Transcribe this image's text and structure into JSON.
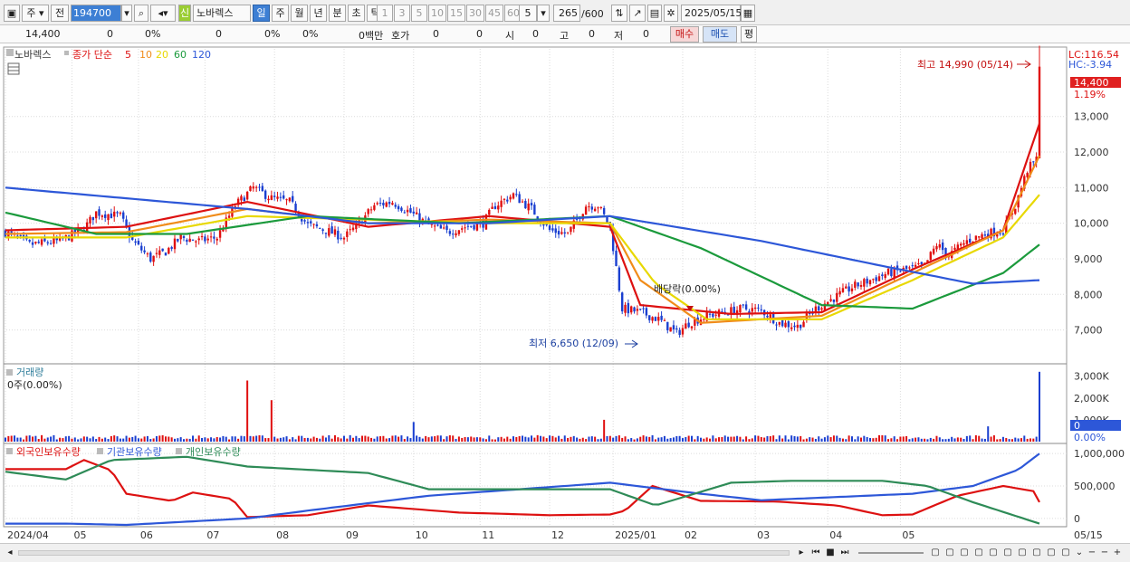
{
  "toolbar": {
    "period_type": "주",
    "prev_label": "전",
    "code": "194700",
    "market_badge": "신",
    "stock_name": "노바렉스",
    "period_buttons": [
      "일",
      "주",
      "월",
      "년",
      "분",
      "초",
      "틱"
    ],
    "selected_period": "일",
    "interval_buttons": [
      "1",
      "3",
      "5",
      "10",
      "15",
      "30",
      "45",
      "60"
    ],
    "interval_value": "5",
    "count_value": "265",
    "count_max": "/600",
    "date": "2025/05/15"
  },
  "quote": {
    "price": "14,400",
    "change": "0",
    "change_pct": "0%",
    "volume": "0",
    "volume_pct": "0%",
    "turnover_pct": "0%",
    "amount": "0백만",
    "hoga_label": "호가",
    "hoga_v1": "0",
    "hoga_v2": "0",
    "open_label": "시",
    "open_v": "0",
    "high_label": "고",
    "high_v": "0",
    "low_label": "저",
    "low_v": "0",
    "buy_label": "매수",
    "sell_label": "매도",
    "avg_label": "평"
  },
  "price_panel": {
    "stock_label": "노바렉스",
    "ma_label": "종가 단순",
    "ma_periods": [
      "5",
      "10",
      "20",
      "60",
      "120"
    ],
    "ma_colors": [
      "#dd1111",
      "#f08c1a",
      "#e8d800",
      "#1b9a3c",
      "#2d57d8"
    ],
    "lc_text": "LC:116.54",
    "hc_text": "HC:-3.94",
    "current_price_tag": "14,400",
    "current_pct_tag": "1.19%",
    "max_annotation": "최고 14,990 (05/14)",
    "min_annotation": "최저 6,650 (12/09)",
    "dividend_annotation": "배당락(0.00%)"
  },
  "volume_panel": {
    "title": "거래량",
    "info": "0주(0.00%)",
    "current_tag": "0",
    "current_pct_tag": "0.00%"
  },
  "holdings_panel": {
    "series_labels": [
      "외국인보유수량",
      "기관보유수량",
      "개인보유수량"
    ],
    "series_colors": [
      "#dd1111",
      "#2d57d8",
      "#2e8b57"
    ]
  },
  "chart_data": [
    {
      "type": "candlestick",
      "title": "노바렉스",
      "x": [
        "2024/04",
        "05",
        "06",
        "07",
        "08",
        "09",
        "10",
        "11",
        "12",
        "2025/01",
        "02",
        "03",
        "04",
        "05"
      ],
      "y_ticks": [
        7000,
        8000,
        9000,
        10000,
        11000,
        12000,
        13000
      ],
      "y_tick_labels": [
        "7,000",
        "8,000",
        "9,000",
        "10,000",
        "11,000",
        "12,000",
        "13,000"
      ],
      "ylim": [
        6100,
        14900
      ],
      "close_path": [
        [
          0,
          9750
        ],
        [
          8,
          9400
        ],
        [
          18,
          9500
        ],
        [
          26,
          9850
        ],
        [
          30,
          10300
        ],
        [
          38,
          10200
        ],
        [
          42,
          9500
        ],
        [
          48,
          9000
        ],
        [
          53,
          9200
        ],
        [
          58,
          9600
        ],
        [
          64,
          9500
        ],
        [
          70,
          9600
        ],
        [
          76,
          10500
        ],
        [
          82,
          11000
        ],
        [
          88,
          10700
        ],
        [
          94,
          10600
        ],
        [
          100,
          9950
        ],
        [
          106,
          9800
        ],
        [
          112,
          9600
        ],
        [
          116,
          9900
        ],
        [
          122,
          10500
        ],
        [
          128,
          10600
        ],
        [
          134,
          10300
        ],
        [
          140,
          9950
        ],
        [
          146,
          9750
        ],
        [
          152,
          9900
        ],
        [
          158,
          10000
        ],
        [
          162,
          10500
        ],
        [
          168,
          10800
        ],
        [
          174,
          10400
        ],
        [
          180,
          9800
        ],
        [
          186,
          9700
        ],
        [
          192,
          10500
        ],
        [
          196,
          10500
        ],
        [
          200,
          9900
        ],
        [
          204,
          7600
        ],
        [
          210,
          7500
        ],
        [
          216,
          7300
        ],
        [
          222,
          6900
        ],
        [
          226,
          7200
        ],
        [
          232,
          7400
        ],
        [
          238,
          7500
        ],
        [
          244,
          7600
        ],
        [
          250,
          7550
        ],
        [
          256,
          7200
        ],
        [
          262,
          7100
        ],
        [
          268,
          7600
        ],
        [
          274,
          7900
        ],
        [
          280,
          8200
        ],
        [
          286,
          8400
        ],
        [
          292,
          8600
        ],
        [
          298,
          8700
        ],
        [
          304,
          8800
        ],
        [
          308,
          9400
        ],
        [
          312,
          9100
        ],
        [
          318,
          9500
        ],
        [
          324,
          9700
        ],
        [
          330,
          9800
        ],
        [
          334,
          10500
        ],
        [
          338,
          11500
        ],
        [
          341,
          11800
        ],
        [
          342,
          14400
        ]
      ],
      "ma_paths": [
        {
          "name": "5",
          "points": [
            [
              0,
              9800
            ],
            [
              40,
              9900
            ],
            [
              80,
              10600
            ],
            [
              120,
              9900
            ],
            [
              160,
              10200
            ],
            [
              200,
              9900
            ],
            [
              210,
              7700
            ],
            [
              240,
              7450
            ],
            [
              270,
              7500
            ],
            [
              300,
              8700
            ],
            [
              330,
              9800
            ],
            [
              342,
              12800
            ]
          ]
        },
        {
          "name": "10",
          "points": [
            [
              0,
              9700
            ],
            [
              40,
              9750
            ],
            [
              80,
              10400
            ],
            [
              120,
              10000
            ],
            [
              160,
              10100
            ],
            [
              200,
              10000
            ],
            [
              210,
              8400
            ],
            [
              230,
              7200
            ],
            [
              270,
              7400
            ],
            [
              300,
              8600
            ],
            [
              330,
              9800
            ],
            [
              342,
              11900
            ]
          ]
        },
        {
          "name": "20",
          "points": [
            [
              0,
              9600
            ],
            [
              40,
              9600
            ],
            [
              80,
              10200
            ],
            [
              120,
              10100
            ],
            [
              160,
              10000
            ],
            [
              200,
              10000
            ],
            [
              215,
              8300
            ],
            [
              232,
              7300
            ],
            [
              270,
              7300
            ],
            [
              300,
              8400
            ],
            [
              330,
              9600
            ],
            [
              342,
              10800
            ]
          ]
        },
        {
          "name": "60",
          "points": [
            [
              0,
              10300
            ],
            [
              30,
              9700
            ],
            [
              60,
              9700
            ],
            [
              100,
              10200
            ],
            [
              150,
              10000
            ],
            [
              200,
              10200
            ],
            [
              230,
              9300
            ],
            [
              270,
              7700
            ],
            [
              300,
              7600
            ],
            [
              330,
              8600
            ],
            [
              342,
              9400
            ]
          ]
        },
        {
          "name": "120",
          "points": [
            [
              0,
              11000
            ],
            [
              40,
              10700
            ],
            [
              80,
              10400
            ],
            [
              120,
              10000
            ],
            [
              160,
              10000
            ],
            [
              200,
              10200
            ],
            [
              250,
              9500
            ],
            [
              290,
              8800
            ],
            [
              320,
              8300
            ],
            [
              342,
              8400
            ]
          ]
        }
      ]
    },
    {
      "type": "bar",
      "title": "거래량",
      "y_ticks": [
        1000,
        2000,
        3000
      ],
      "y_tick_labels": [
        "1,000K",
        "2,000K",
        "3,000K"
      ],
      "ylim": [
        0,
        3400
      ],
      "spikes": [
        [
          80,
          2800
        ],
        [
          88,
          1900
        ],
        [
          135,
          900
        ],
        [
          198,
          1000
        ],
        [
          325,
          700
        ],
        [
          342,
          3200
        ]
      ],
      "baseline": 200
    },
    {
      "type": "line",
      "title": "외국인보유수량 / 기관보유수량 / 개인보유수량",
      "y_ticks": [
        0,
        500000,
        1000000
      ],
      "y_tick_labels": [
        "0",
        "500,000",
        "1,000,000"
      ],
      "ylim": [
        -100000,
        1100000
      ],
      "series": [
        {
          "name": "외국인보유수량",
          "points": [
            [
              0,
              760000
            ],
            [
              20,
              760000
            ],
            [
              26,
              900000
            ],
            [
              35,
              740000
            ],
            [
              40,
              380000
            ],
            [
              55,
              270000
            ],
            [
              62,
              400000
            ],
            [
              75,
              300000
            ],
            [
              80,
              20000
            ],
            [
              100,
              50000
            ],
            [
              120,
              200000
            ],
            [
              150,
              90000
            ],
            [
              180,
              50000
            ],
            [
              200,
              60000
            ],
            [
              205,
              120000
            ],
            [
              214,
              500000
            ],
            [
              230,
              270000
            ],
            [
              255,
              260000
            ],
            [
              275,
              200000
            ],
            [
              290,
              50000
            ],
            [
              300,
              60000
            ],
            [
              315,
              350000
            ],
            [
              330,
              500000
            ],
            [
              340,
              420000
            ],
            [
              342,
              250000
            ]
          ]
        },
        {
          "name": "기관보유수량",
          "points": [
            [
              0,
              -80000
            ],
            [
              20,
              -80000
            ],
            [
              40,
              -100000
            ],
            [
              80,
              0
            ],
            [
              100,
              120000
            ],
            [
              140,
              350000
            ],
            [
              200,
              550000
            ],
            [
              230,
              380000
            ],
            [
              250,
              280000
            ],
            [
              300,
              380000
            ],
            [
              320,
              500000
            ],
            [
              335,
              750000
            ],
            [
              342,
              1000000
            ]
          ]
        },
        {
          "name": "개인보유수량",
          "points": [
            [
              0,
              720000
            ],
            [
              20,
              600000
            ],
            [
              35,
              900000
            ],
            [
              60,
              950000
            ],
            [
              80,
              800000
            ],
            [
              120,
              700000
            ],
            [
              140,
              450000
            ],
            [
              200,
              450000
            ],
            [
              215,
              200000
            ],
            [
              240,
              550000
            ],
            [
              260,
              580000
            ],
            [
              290,
              580000
            ],
            [
              305,
              500000
            ],
            [
              320,
              250000
            ],
            [
              342,
              -80000
            ]
          ]
        }
      ]
    }
  ],
  "time_axis": [
    "2024/04",
    "05",
    "06",
    "07",
    "08",
    "09",
    "10",
    "11",
    "12",
    "2025/01",
    "02",
    "03",
    "04",
    "05",
    "05/15"
  ]
}
